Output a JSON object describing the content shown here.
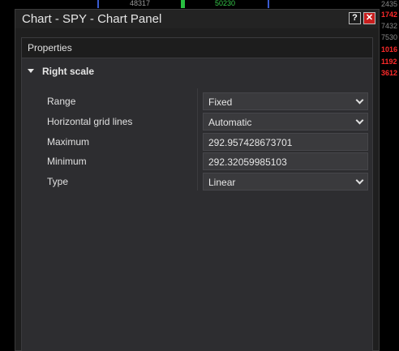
{
  "top_strip": {
    "left_value": "48317",
    "center_value": "50230",
    "colors": {
      "blue_marker": "#3a5bd0",
      "green_marker": "#28c040"
    }
  },
  "right_column": {
    "values": [
      {
        "text": "2435",
        "style": "gray"
      },
      {
        "text": "1742",
        "style": "red"
      },
      {
        "text": "7432",
        "style": "gray"
      },
      {
        "text": "7530",
        "style": "gray"
      },
      {
        "text": "1016",
        "style": "red"
      },
      {
        "text": "1192",
        "style": "red"
      },
      {
        "text": "3612",
        "style": "red"
      }
    ]
  },
  "window": {
    "title": "Chart - SPY - Chart Panel",
    "help_label": "?",
    "close_label": "✕"
  },
  "properties": {
    "header": "Properties",
    "section_label": "Right scale",
    "rows": [
      {
        "label": "Range",
        "value": "Fixed",
        "dropdown": true
      },
      {
        "label": "Horizontal grid lines",
        "value": "Automatic",
        "dropdown": true
      },
      {
        "label": "Maximum",
        "value": "292.957428673701",
        "dropdown": false
      },
      {
        "label": "Minimum",
        "value": "292.32059985103",
        "dropdown": false
      },
      {
        "label": "Type",
        "value": "Linear",
        "dropdown": true
      }
    ]
  }
}
